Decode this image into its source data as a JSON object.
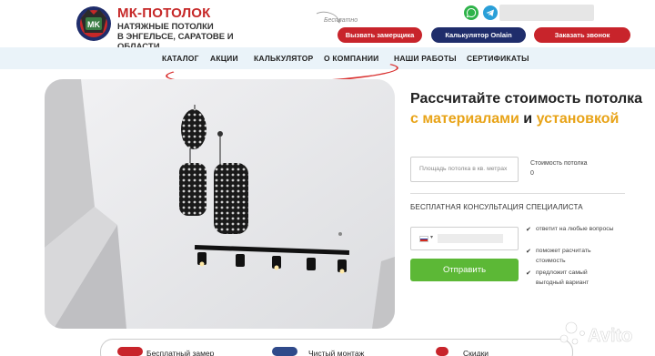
{
  "header": {
    "brand": "МК-ПОТОЛОК",
    "logo_text": "MK",
    "tagline_line1": "НАТЯЖНЫЕ ПОТОЛКИ",
    "tagline_line2": "В ЭНГЕЛЬСЕ, САРАТОВЕ И ОБЛАСТИ",
    "free_note": "Бесплатно",
    "buttons": {
      "measure": "Вызвать замерщика",
      "calculator": "Калькулятор Onlain",
      "call": "Заказать звонок"
    }
  },
  "nav": {
    "items": [
      "КАТАЛОГ",
      "АКЦИИ",
      "КАЛЬКУЛЯТОР",
      "О КОМПАНИИ",
      "НАШИ РАБОТЫ",
      "СЕРТИФИКАТЫ"
    ]
  },
  "calculator": {
    "title_part1": "Рассчитайте стоимость потолка ",
    "title_accent1": "с материалами",
    "title_part2": " и ",
    "title_accent2": "установкой",
    "area_placeholder": "Площадь потолка в кв. метрах",
    "cost_label": "Стоимость потолка",
    "cost_value": "0",
    "consult_heading": "БЕСПЛАТНАЯ КОНСУЛЬТАЦИЯ СПЕЦИАЛИСТА",
    "phone_flag_caret": "▾",
    "submit_label": "Отправить",
    "benefits": [
      "ответит на любые вопросы",
      "поможет расчитать стоимость",
      "предложит самый выгодный вариант"
    ],
    "check_glyph": "✔"
  },
  "features": [
    "Бесплатный замер",
    "Чистый монтаж",
    "Скидки"
  ],
  "watermark": {
    "text": "Avito"
  },
  "colors": {
    "brand_red": "#c62828",
    "button_red": "#c8242b",
    "button_navy": "#1f2d6b",
    "accent_orange": "#e8a317",
    "submit_green": "#5cb836",
    "nav_bg": "#eaf3f9"
  }
}
